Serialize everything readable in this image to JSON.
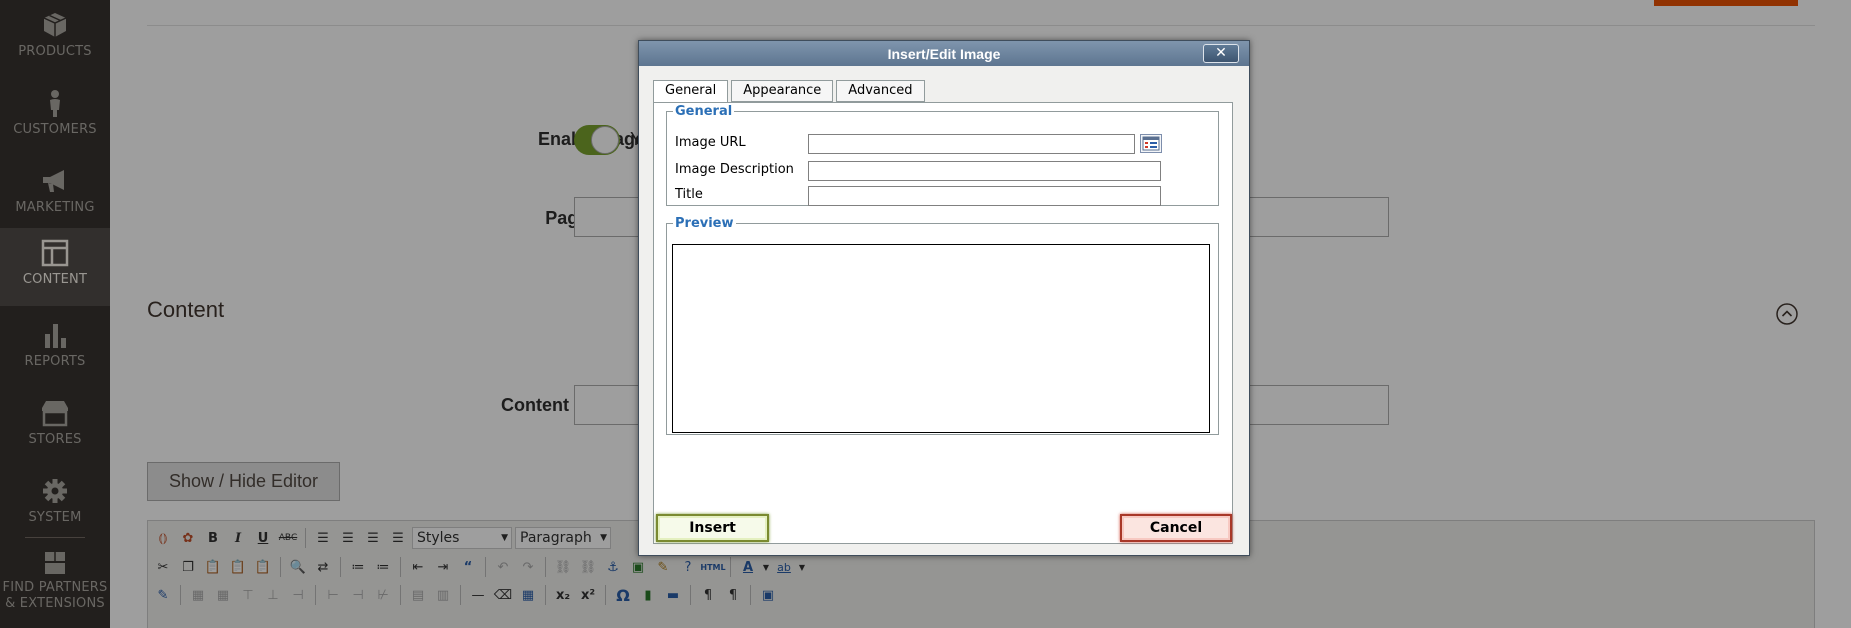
{
  "sidebar": {
    "items": [
      {
        "label": "PRODUCTS",
        "icon": "cube-icon"
      },
      {
        "label": "CUSTOMERS",
        "icon": "person-icon"
      },
      {
        "label": "MARKETING",
        "icon": "megaphone-icon"
      },
      {
        "label": "CONTENT",
        "icon": "layout-icon",
        "active": true
      },
      {
        "label": "REPORTS",
        "icon": "bar-chart-icon"
      },
      {
        "label": "STORES",
        "icon": "storefront-icon"
      },
      {
        "label": "SYSTEM",
        "icon": "gear-icon"
      },
      {
        "label": "FIND PARTNERS & EXTENSIONS",
        "label_line1": "FIND PARTNERS",
        "label_line2": "& EXTENSIONS",
        "icon": "boxes-icon"
      }
    ]
  },
  "form": {
    "enable_page_label": "Enable Page",
    "enable_page_value": "Y",
    "page_title_label": "Page Title",
    "required_mark": "*",
    "content_section_title": "Content",
    "content_heading_label": "Content Heading",
    "show_hide_editor_label": "Show / Hide Editor"
  },
  "editor_toolbar": {
    "styles_select": "Styles",
    "format_select": "Paragraph",
    "bold": "B",
    "italic": "I",
    "underline": "U",
    "strikethrough": "ABC",
    "html": "HTML",
    "omega": "Ω",
    "font_color": "A",
    "highlight": "ab"
  },
  "dialog": {
    "title": "Insert/Edit Image",
    "close": "✕",
    "tabs": [
      {
        "label": "General",
        "active": true
      },
      {
        "label": "Appearance"
      },
      {
        "label": "Advanced"
      }
    ],
    "general_legend": "General",
    "fields": {
      "image_url_label": "Image URL",
      "image_url_value": "",
      "image_description_label": "Image Description",
      "image_description_value": "",
      "title_label": "Title",
      "title_value": ""
    },
    "preview_legend": "Preview",
    "insert_label": "Insert",
    "cancel_label": "Cancel"
  },
  "colors": {
    "sidebar_bg": "#373330",
    "sidebar_active_bg": "#524d49",
    "accent_orange": "#eb5202",
    "toggle_on": "#79a22e",
    "legend_blue": "#2b6fb6",
    "dialog_title_bg": "#6d849e"
  }
}
